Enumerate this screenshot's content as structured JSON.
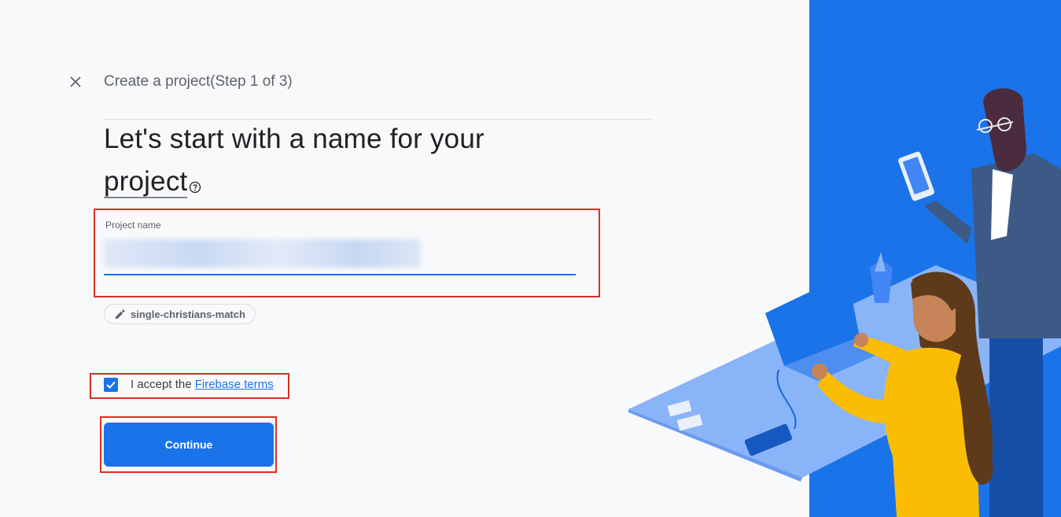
{
  "header": {
    "close_icon": "close-icon",
    "step_title": "Create a project(Step 1 of 3)"
  },
  "main": {
    "heading_part1": "Let's start with a name for your ",
    "heading_term": "project",
    "help_icon": "help-circle-icon"
  },
  "project_name_field": {
    "label": "Project name",
    "value": ""
  },
  "project_id_chip": {
    "icon": "pencil-icon",
    "value": "single-christians-match"
  },
  "terms": {
    "checked": true,
    "text_prefix": "I accept the ",
    "link_text": "Firebase terms"
  },
  "actions": {
    "continue_label": "Continue"
  },
  "colors": {
    "accent": "#1a73e8",
    "highlight": "#d93025",
    "illustration_bg": "#1a73e8"
  }
}
